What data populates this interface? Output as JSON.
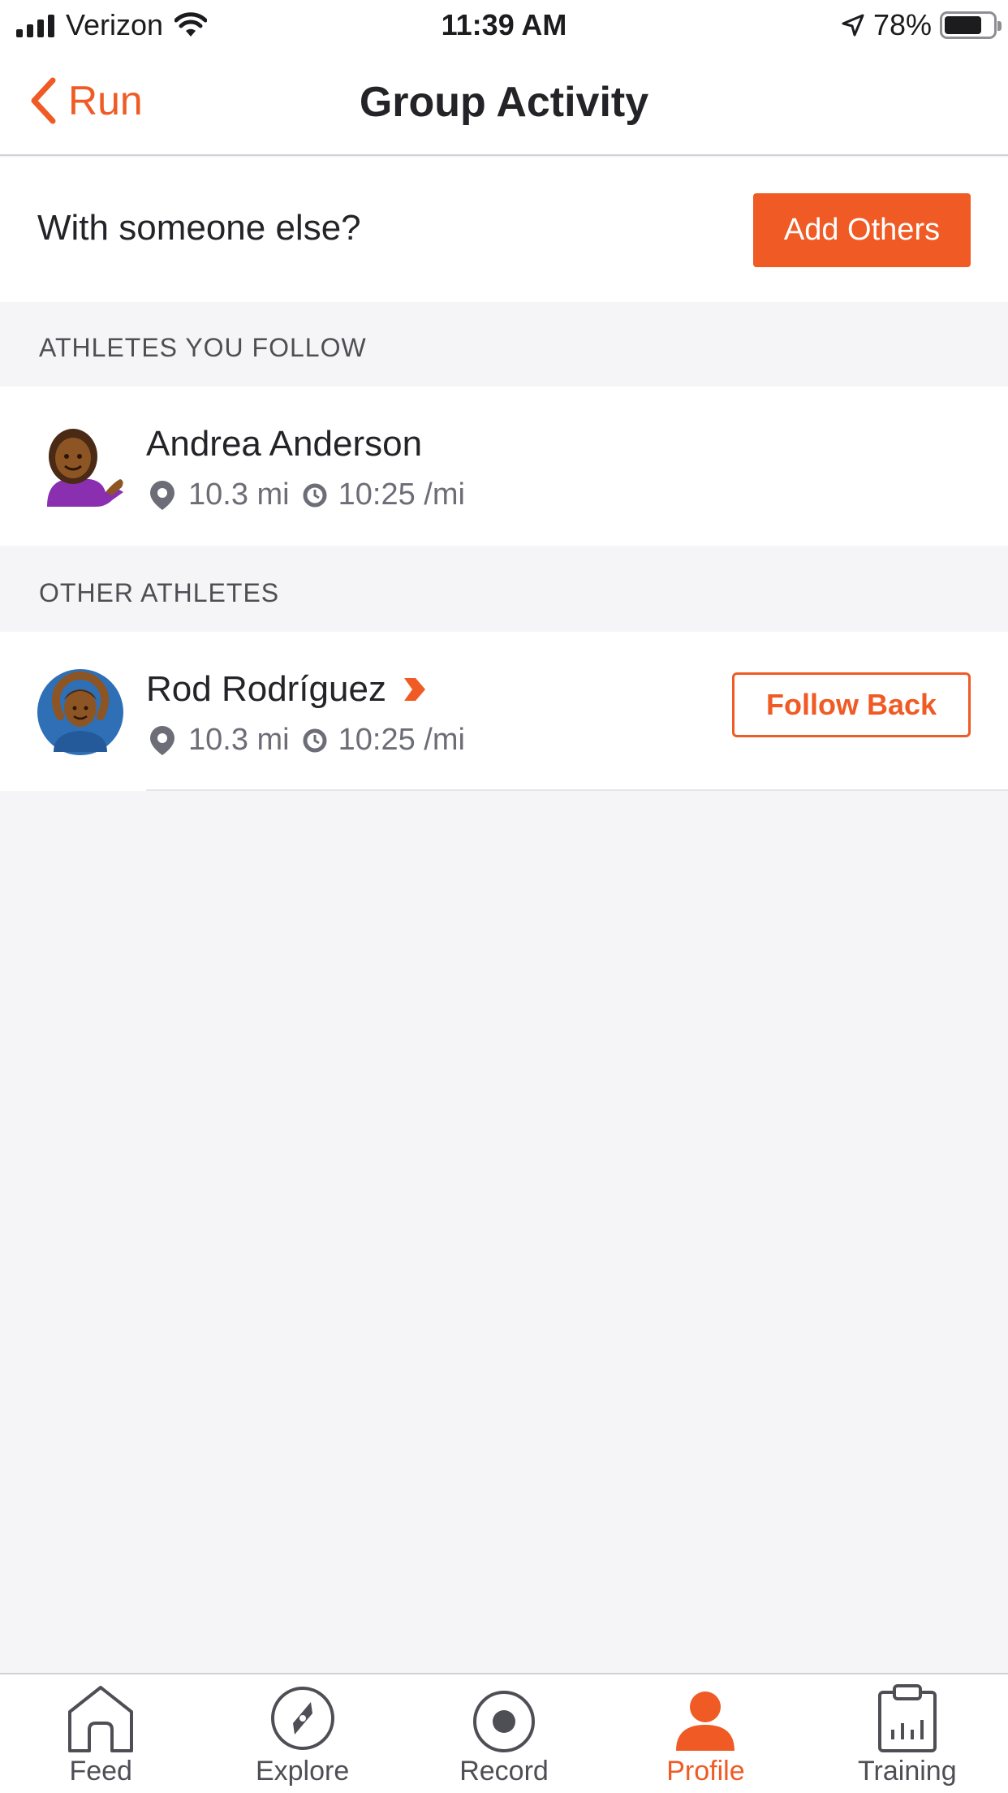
{
  "status_bar": {
    "carrier": "Verizon",
    "time": "11:39 AM",
    "battery_percent": "78%",
    "battery_level": 0.78
  },
  "nav": {
    "back_label": "Run",
    "title": "Group Activity"
  },
  "invite": {
    "prompt": "With someone else?",
    "button_label": "Add Others"
  },
  "sections": {
    "following_header": "ATHLETES YOU FOLLOW",
    "other_header": "OTHER ATHLETES"
  },
  "athletes_following": [
    {
      "name": "Andrea Anderson",
      "distance": "10.3 mi",
      "pace": "10:25 /mi",
      "avatar_icon": "woman-tipping-hand-emoji"
    }
  ],
  "athletes_other": [
    {
      "name": "Rod Rodríguez",
      "distance": "10.3 mi",
      "pace": "10:25 /mi",
      "avatar_icon": "man-gesturing-ok-emoji",
      "badge_icon": "subscriber-chevron-icon",
      "action_label": "Follow Back"
    }
  ],
  "tab_bar": {
    "tabs": [
      {
        "label": "Feed",
        "icon": "home-icon"
      },
      {
        "label": "Explore",
        "icon": "compass-icon"
      },
      {
        "label": "Record",
        "icon": "record-icon"
      },
      {
        "label": "Profile",
        "icon": "person-icon",
        "active": true
      },
      {
        "label": "Training",
        "icon": "clipboard-chart-icon"
      }
    ]
  },
  "colors": {
    "accent": "#f05a24",
    "text_primary": "#242428",
    "text_secondary": "#6d6d78",
    "background": "#f5f5f7"
  }
}
